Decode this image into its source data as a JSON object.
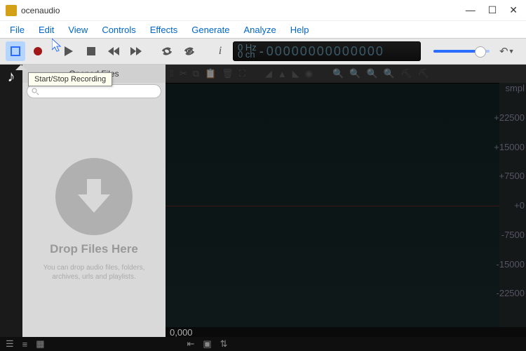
{
  "window": {
    "title": "ocenaudio"
  },
  "menu": [
    "File",
    "Edit",
    "View",
    "Controls",
    "Effects",
    "Generate",
    "Analyze",
    "Help"
  ],
  "tooltip": "Start/Stop Recording",
  "meter": {
    "hz": "0 Hz",
    "ch": "0 ch",
    "sep": "-",
    "digits": "00000000000000"
  },
  "sidebar": {
    "title": "Opened Files",
    "drop_title": "Drop Files Here",
    "drop_sub": "You can drop audio files, folders, archives, urls and playlists."
  },
  "ruler": {
    "unit": "smpl",
    "ticks": [
      "+22500",
      "+15000",
      "+7500",
      "+0",
      "-7500",
      "-15000",
      "-22500"
    ]
  },
  "timecode": "0,000"
}
